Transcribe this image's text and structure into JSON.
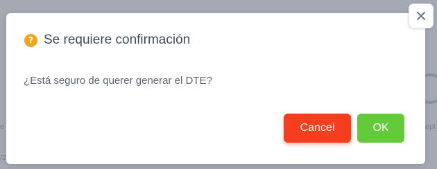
{
  "dialog": {
    "title": "Se requiere confirmación",
    "message": "¿Está seguro de querer generar el DTE?",
    "cancel_label": "Cancel",
    "ok_label": "OK",
    "icon": "question-circle-icon",
    "close_icon": "close-icon"
  },
  "background": {
    "fragment_right": "ept",
    "fragment_left_small": "e",
    "fragment_left_bottom": "/2"
  },
  "colors": {
    "cancel": "#f53e1e",
    "ok": "#63cb3a",
    "question_icon": "#f3a31f"
  }
}
